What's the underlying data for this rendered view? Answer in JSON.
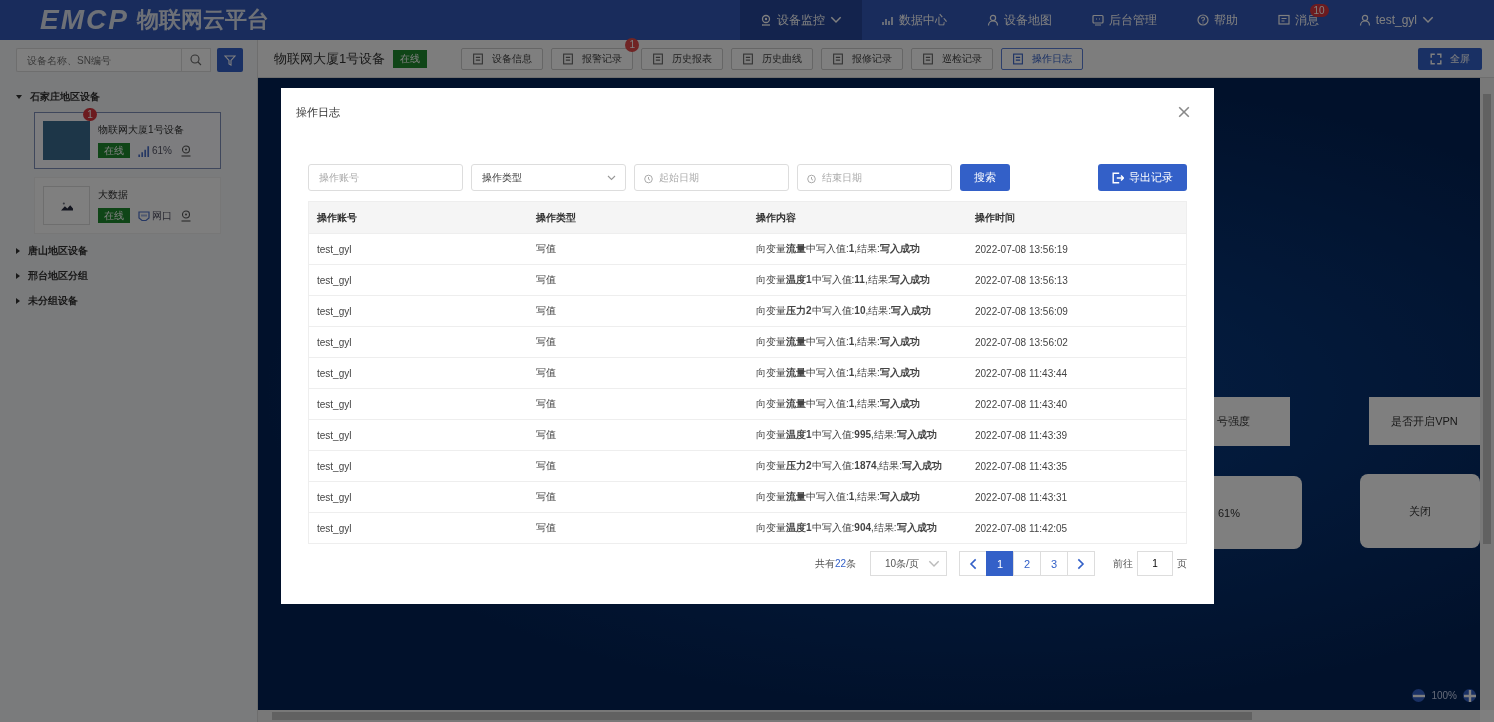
{
  "header": {
    "logo": "EMCP",
    "title": "物联网云平台",
    "nav": [
      {
        "label": "设备监控",
        "selected": true,
        "caret": true
      },
      {
        "label": "数据中心",
        "selected": false,
        "caret": false
      },
      {
        "label": "设备地图",
        "selected": false,
        "caret": false
      },
      {
        "label": "后台管理",
        "selected": false,
        "caret": false
      },
      {
        "label": "帮助",
        "selected": false,
        "caret": false
      },
      {
        "label": "消息",
        "selected": false,
        "caret": false,
        "badge": "10"
      },
      {
        "label": "test_gyl",
        "selected": false,
        "caret": true
      }
    ]
  },
  "sidebar": {
    "search": {
      "placeholder": "设备名称、SN编号"
    },
    "groups": [
      {
        "label": "石家庄地区设备",
        "expanded": true,
        "children": [
          {
            "name": "物联网大厦1号设备",
            "thumb": {
              "kind": "photo"
            },
            "badge": "1",
            "status": "在线",
            "link": {
              "kind": "signal",
              "text": "61%"
            },
            "selected": true
          },
          {
            "name": "大数据",
            "thumb": {
              "kind": "generic"
            },
            "status": "在线",
            "link": {
              "kind": "ethernet",
              "text": "网口"
            },
            "selected": false
          }
        ]
      },
      {
        "label": "唐山地区设备",
        "expanded": false
      },
      {
        "label": "邢台地区分组",
        "expanded": false
      },
      {
        "label": "未分组设备",
        "expanded": false
      }
    ]
  },
  "toolbar": {
    "device": "物联网大厦1号设备",
    "status": "在线",
    "buttons": [
      {
        "label": "设备信息",
        "selected": false
      },
      {
        "label": "报警记录",
        "selected": false,
        "badge": "1"
      },
      {
        "label": "历史报表",
        "selected": false
      },
      {
        "label": "历史曲线",
        "selected": false
      },
      {
        "label": "报修记录",
        "selected": false
      },
      {
        "label": "巡检记录",
        "selected": false
      },
      {
        "label": "操作日志",
        "selected": true
      }
    ],
    "fullscreen": "全屏"
  },
  "canvas": {
    "cards": [
      {
        "text": "号强度",
        "kind": "label"
      },
      {
        "text": "是否开启VPN",
        "kind": "label"
      },
      {
        "text": "61%",
        "kind": "value"
      },
      {
        "text": "关闭",
        "kind": "value"
      }
    ],
    "zoom": "100%"
  },
  "modal": {
    "title": "操作日志",
    "filters": {
      "account": {
        "placeholder": "操作账号"
      },
      "type": {
        "placeholder": "操作类型"
      },
      "start": {
        "placeholder": "起始日期"
      },
      "end": {
        "placeholder": "结束日期"
      },
      "search": "搜索",
      "export": "导出记录"
    },
    "table": {
      "columns": [
        "操作账号",
        "操作类型",
        "操作内容",
        "操作时间"
      ],
      "rows": [
        [
          "test_gyl",
          "写值",
          "向变量**流量**中写入值:**1**,结果:**写入成功**",
          "2022-07-08 13:56:19"
        ],
        [
          "test_gyl",
          "写值",
          "向变量**温度1**中写入值:**11**,结果:**写入成功**",
          "2022-07-08 13:56:13"
        ],
        [
          "test_gyl",
          "写值",
          "向变量**压力2**中写入值:**10**,结果:**写入成功**",
          "2022-07-08 13:56:09"
        ],
        [
          "test_gyl",
          "写值",
          "向变量**流量**中写入值:**1**,结果:**写入成功**",
          "2022-07-08 13:56:02"
        ],
        [
          "test_gyl",
          "写值",
          "向变量**流量**中写入值:**1**,结果:**写入成功**",
          "2022-07-08 11:43:44"
        ],
        [
          "test_gyl",
          "写值",
          "向变量**流量**中写入值:**1**,结果:**写入成功**",
          "2022-07-08 11:43:40"
        ],
        [
          "test_gyl",
          "写值",
          "向变量**温度1**中写入值:**995**,结果:**写入成功**",
          "2022-07-08 11:43:39"
        ],
        [
          "test_gyl",
          "写值",
          "向变量**压力2**中写入值:**1874**,结果:**写入成功**",
          "2022-07-08 11:43:35"
        ],
        [
          "test_gyl",
          "写值",
          "向变量**流量**中写入值:**1**,结果:**写入成功**",
          "2022-07-08 11:43:31"
        ],
        [
          "test_gyl",
          "写值",
          "向变量**温度1**中写入值:**904**,结果:**写入成功**",
          "2022-07-08 11:42:05"
        ]
      ]
    },
    "pagination": {
      "total_prefix": "共有",
      "total": "22",
      "total_suffix": "条",
      "page_size": "10条/页",
      "pages": [
        {
          "label": "1",
          "selected": true
        },
        {
          "label": "2",
          "selected": false
        },
        {
          "label": "3",
          "selected": false
        }
      ],
      "goto_label": "前往",
      "goto_value": "1",
      "goto_suffix": "页"
    }
  }
}
